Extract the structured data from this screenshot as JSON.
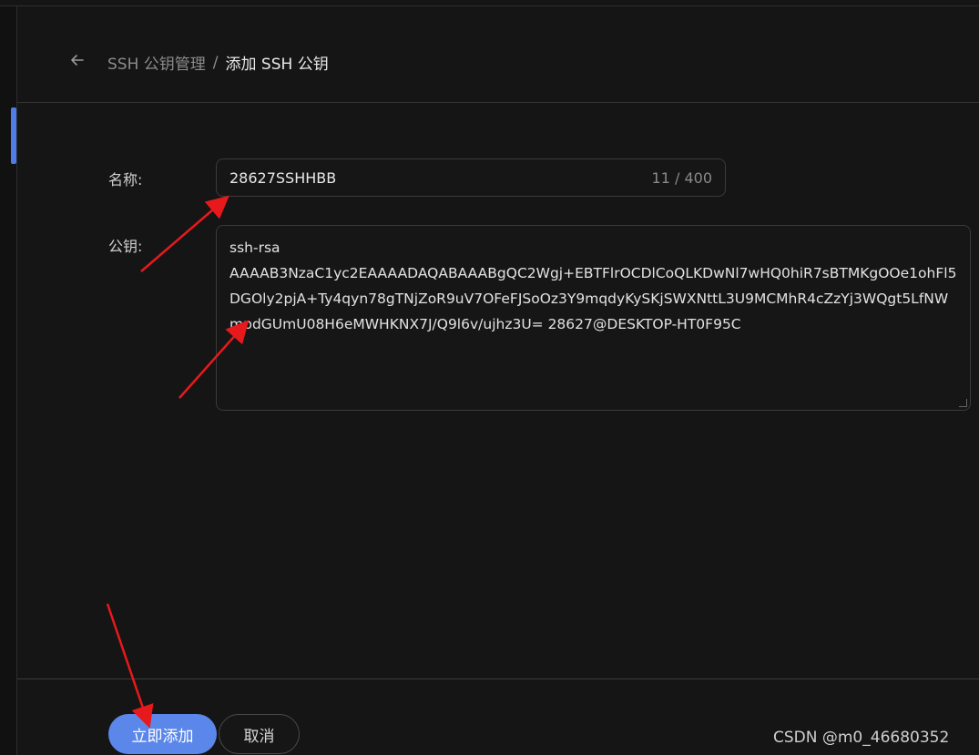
{
  "breadcrumb": {
    "parent": "SSH 公钥管理",
    "separator": "/",
    "current": "添加 SSH 公钥"
  },
  "form": {
    "name_label": "名称:",
    "name_value": "28627SSHHBB",
    "name_counter": "11 / 400",
    "key_label": "公钥:",
    "key_value": "ssh-rsa\nAAAAB3NzaC1yc2EAAAADAQABAAABgQC2Wgj+EBTFlrOCDlCoQLKDwNl7wHQ0hiR7sBTMKgOOe1ohFl5DGOly2pjA+Ty4qyn78gTNjZoR9uV7OFeFJSoOz3Y9mqdyKySKjSWXNttL3U9MCMhR4cZzYj3WQgt5LfNWmpdGUmU08H6eMWHKNX7J/Q9l6v/ujhz3U= 28627@DESKTOP-HT0F95C"
  },
  "actions": {
    "submit_label": "立即添加",
    "cancel_label": "取消"
  },
  "watermark": "CSDN @m0_46680352",
  "colors": {
    "accent": "#5b87ea",
    "background": "#151515",
    "annotation_arrow": "#e8191c"
  },
  "icons": {
    "back": "arrow-left-icon"
  }
}
